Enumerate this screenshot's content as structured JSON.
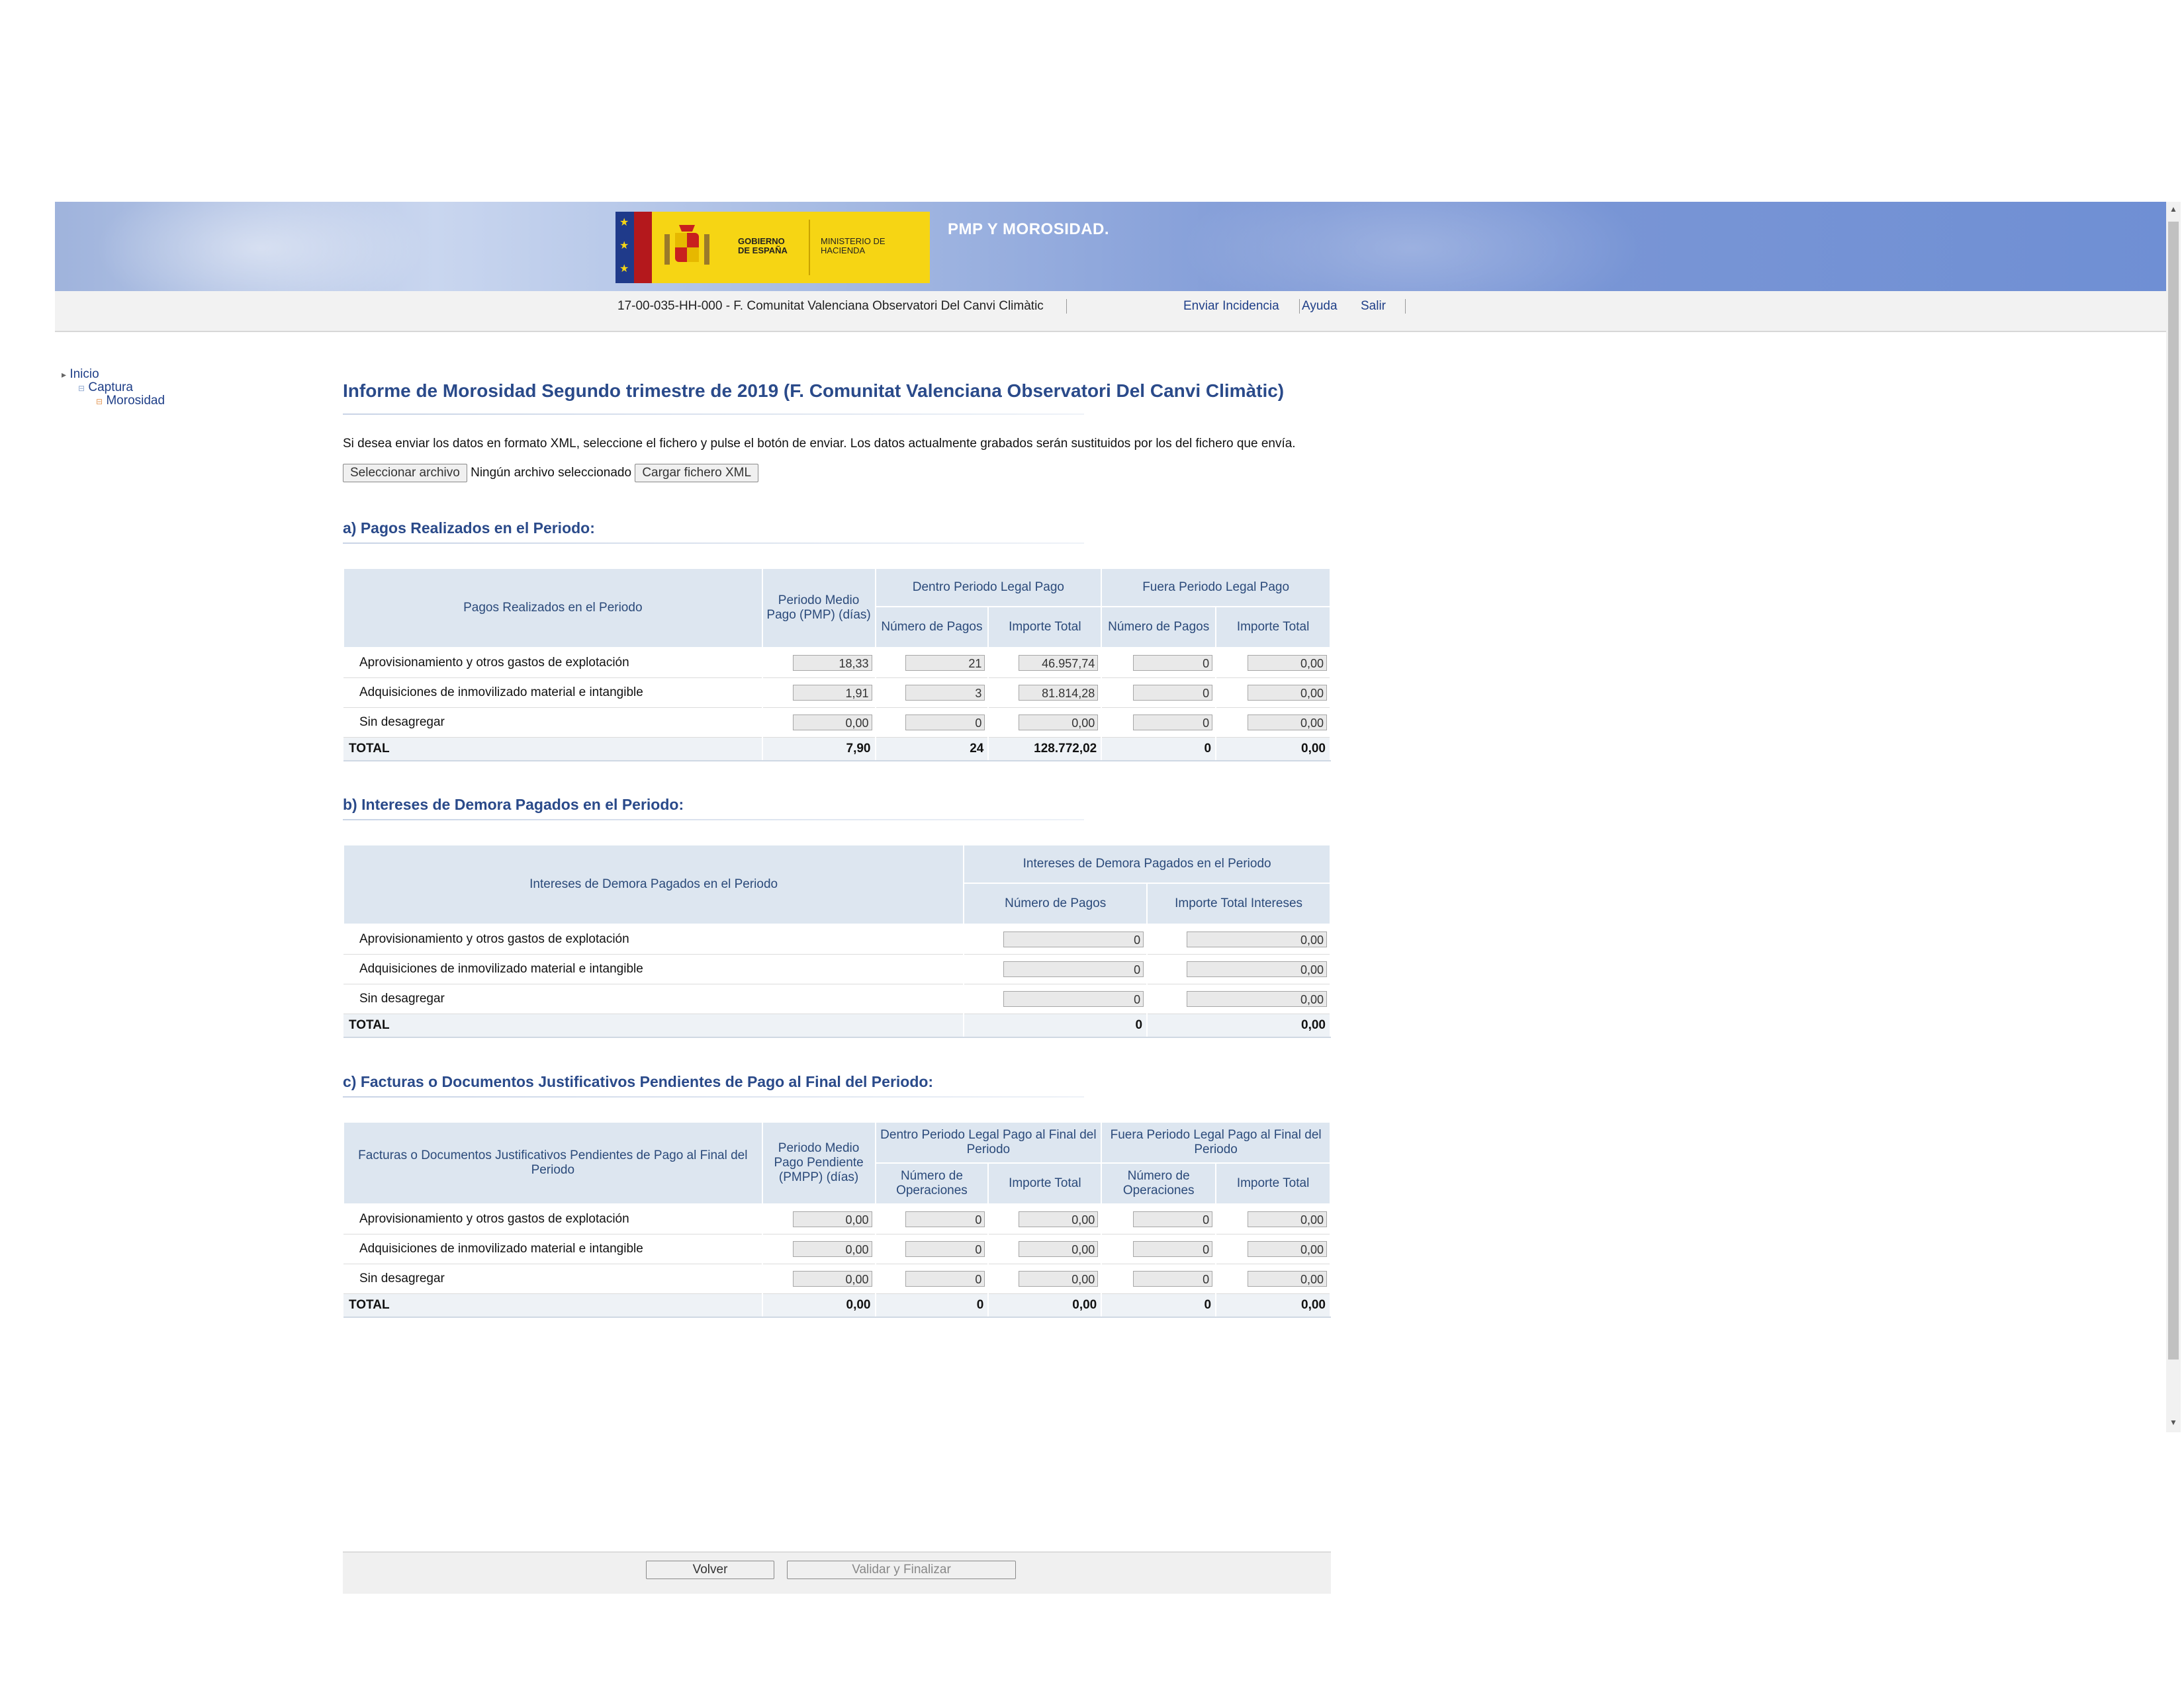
{
  "header": {
    "app_title": "PMP Y MOROSIDAD.",
    "logo_gov": "GOBIERNO DE ESPAÑA",
    "logo_min": "MINISTERIO DE HACIENDA",
    "org": "17-00-035-HH-000 - F. Comunitat Valenciana Observatori Del Canvi Climàtic",
    "links": {
      "incidencia": "Enviar Incidencia",
      "ayuda": "Ayuda",
      "salir": "Salir"
    }
  },
  "nav": {
    "items": [
      "Inicio",
      "Captura",
      "Morosidad"
    ]
  },
  "page": {
    "title": "Informe de Morosidad Segundo trimestre de 2019 (F. Comunitat Valenciana Observatori Del Canvi Climàtic)",
    "info": "Si desea enviar los datos en formato XML, seleccione el fichero y pulse el botón de enviar. Los datos actualmente grabados serán sustituidos por los del fichero que envía.",
    "file_button": "Seleccionar archivo",
    "file_status": "Ningún archivo seleccionado",
    "load_button": "Cargar fichero XML"
  },
  "section_a": {
    "title": "a) Pagos Realizados en el Periodo:",
    "h_row": "Pagos Realizados en el Periodo",
    "h_pmp": "Periodo Medio Pago (PMP) (días)",
    "h_dentro": "Dentro Periodo Legal Pago",
    "h_fuera": "Fuera Periodo Legal Pago",
    "h_num": "Número de Pagos",
    "h_imp": "Importe Total",
    "rows": [
      {
        "label": "Aprovisionamiento y otros gastos de explotación",
        "pmp": "18,33",
        "dn": "21",
        "di": "46.957,74",
        "fn": "0",
        "fi": "0,00"
      },
      {
        "label": "Adquisiciones de inmovilizado material e intangible",
        "pmp": "1,91",
        "dn": "3",
        "di": "81.814,28",
        "fn": "0",
        "fi": "0,00"
      },
      {
        "label": "Sin desagregar",
        "pmp": "0,00",
        "dn": "0",
        "di": "0,00",
        "fn": "0",
        "fi": "0,00"
      }
    ],
    "total": {
      "label": "TOTAL",
      "pmp": "7,90",
      "dn": "24",
      "di": "128.772,02",
      "fn": "0",
      "fi": "0,00"
    }
  },
  "section_b": {
    "title": "b) Intereses de Demora Pagados en el Periodo:",
    "h_row": "Intereses de Demora Pagados en el Periodo",
    "h_group": "Intereses de Demora Pagados en el Periodo",
    "h_num": "Número de Pagos",
    "h_imp": "Importe Total Intereses",
    "rows": [
      {
        "label": "Aprovisionamiento y otros gastos de explotación",
        "n": "0",
        "i": "0,00"
      },
      {
        "label": "Adquisiciones de inmovilizado material e intangible",
        "n": "0",
        "i": "0,00"
      },
      {
        "label": "Sin desagregar",
        "n": "0",
        "i": "0,00"
      }
    ],
    "total": {
      "label": "TOTAL",
      "n": "0",
      "i": "0,00"
    }
  },
  "section_c": {
    "title": "c) Facturas o Documentos Justificativos Pendientes de Pago al Final del Periodo:",
    "h_row": "Facturas o Documentos Justificativos Pendientes de Pago al Final del Periodo",
    "h_pmpp": "Periodo Medio Pago Pendiente (PMPP) (días)",
    "h_dentro": "Dentro Periodo Legal Pago al Final del Periodo",
    "h_fuera": "Fuera Periodo Legal Pago al Final del Periodo",
    "h_num": "Número de Operaciones",
    "h_imp": "Importe Total",
    "rows": [
      {
        "label": "Aprovisionamiento y otros gastos de explotación",
        "pmp": "0,00",
        "dn": "0",
        "di": "0,00",
        "fn": "0",
        "fi": "0,00"
      },
      {
        "label": "Adquisiciones de inmovilizado material e intangible",
        "pmp": "0,00",
        "dn": "0",
        "di": "0,00",
        "fn": "0",
        "fi": "0,00"
      },
      {
        "label": "Sin desagregar",
        "pmp": "0,00",
        "dn": "0",
        "di": "0,00",
        "fn": "0",
        "fi": "0,00"
      }
    ],
    "total": {
      "label": "TOTAL",
      "pmp": "0,00",
      "dn": "0",
      "di": "0,00",
      "fn": "0",
      "fi": "0,00"
    }
  },
  "footer": {
    "back": "Volver",
    "validate": "Validar y Finalizar"
  }
}
